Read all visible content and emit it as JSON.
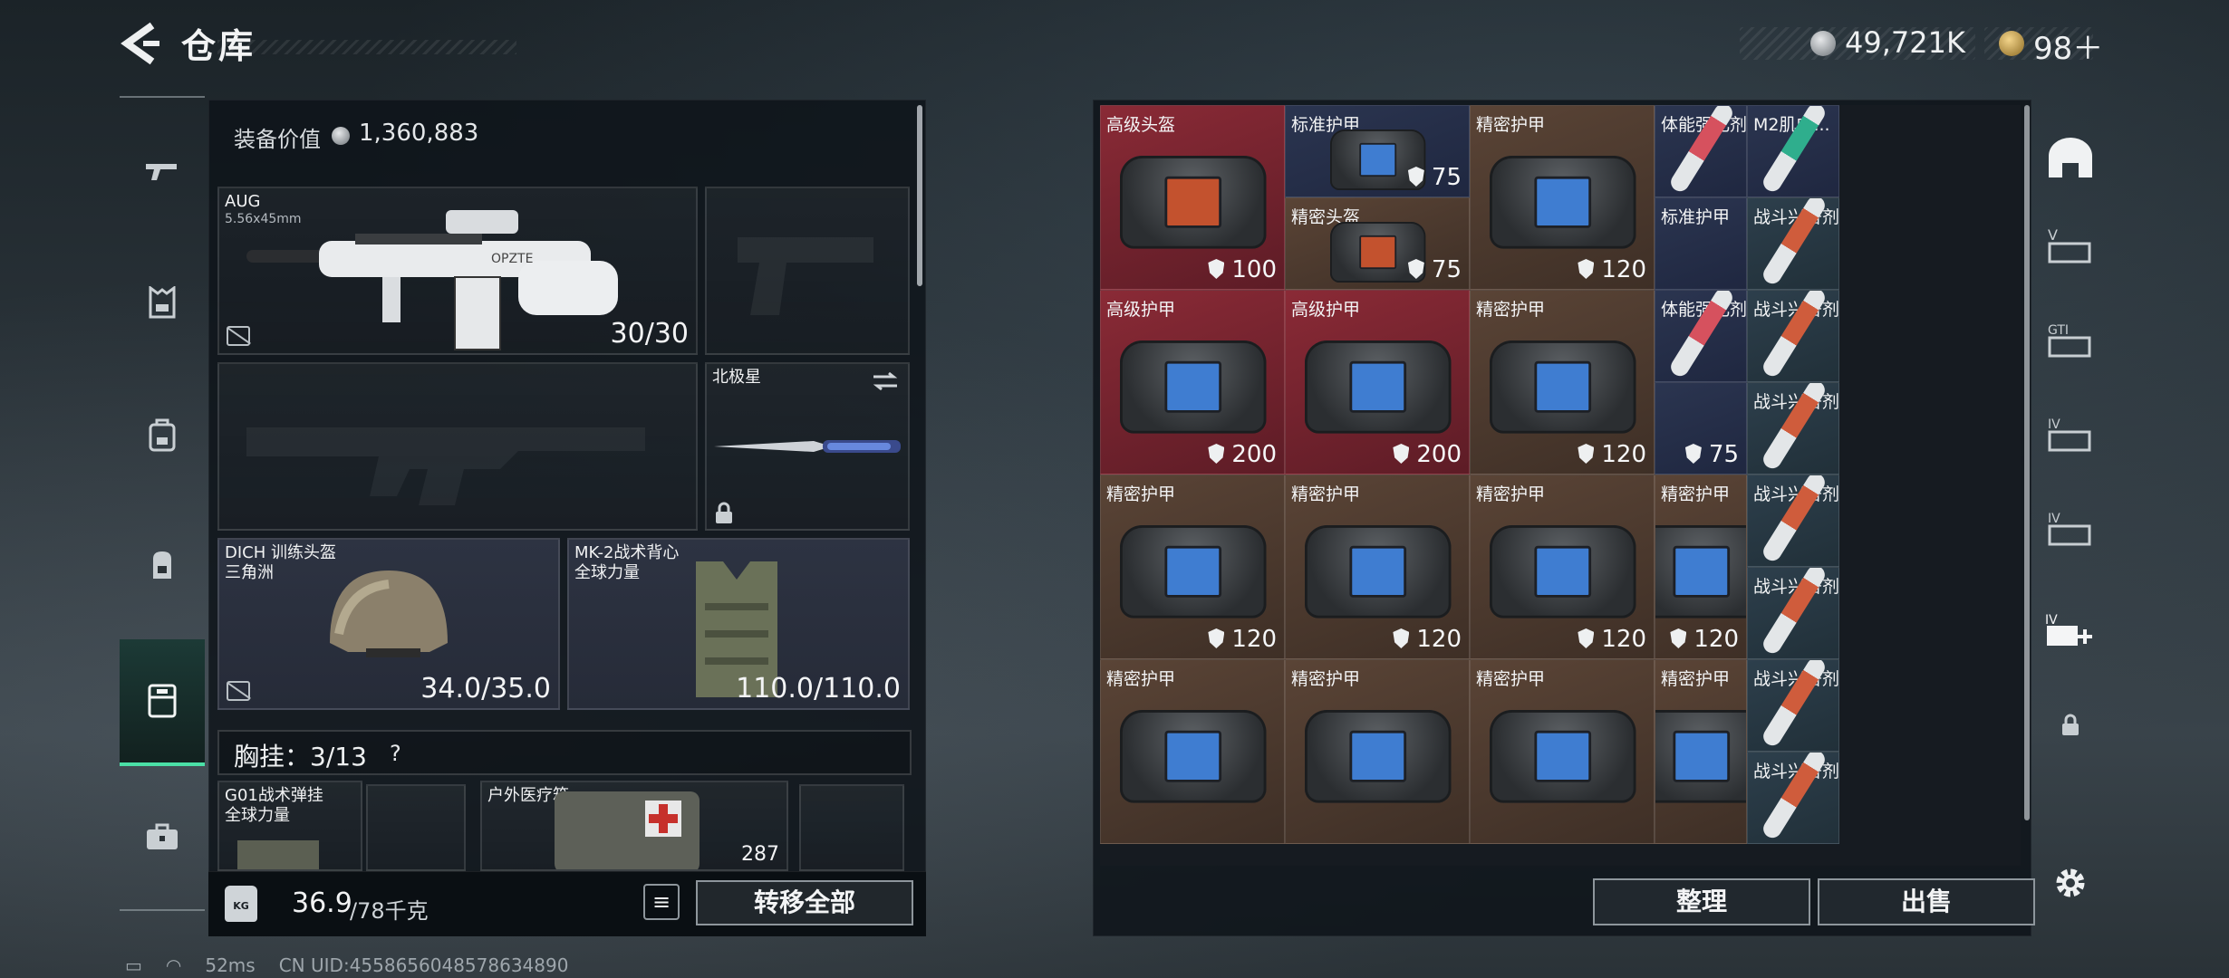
{
  "header": {
    "title": "仓库",
    "currency1": "49,721K",
    "currency2": "98＋"
  },
  "left_nav": {
    "items": [
      {
        "name": "weapon",
        "icon": "gun-icon"
      },
      {
        "name": "vest",
        "icon": "vest-icon"
      },
      {
        "name": "backpack-alt",
        "icon": "bag-icon"
      },
      {
        "name": "pack",
        "icon": "backpack-icon"
      },
      {
        "name": "storage",
        "icon": "locker-icon",
        "active": true
      },
      {
        "name": "case",
        "icon": "briefcase-icon"
      }
    ]
  },
  "equipment": {
    "value_label": "装备价值",
    "value": "1,360,883",
    "primary": {
      "name": "AUG",
      "caliber": "5.56x45mm",
      "ammo": "30/30"
    },
    "melee": {
      "name": "北极星"
    },
    "helmet": {
      "name": "DICH 训练头盔\n三角洲",
      "durability": "34.0/35.0"
    },
    "armor": {
      "name": "MK-2战术背心\n全球力量",
      "durability": "110.0/110.0"
    },
    "rig": {
      "label": "胸挂：3/13",
      "help": "?"
    },
    "rig_items": [
      {
        "name": "G01战术弹挂\n全球力量"
      },
      {
        "name": "户外医疗箱",
        "value": "287"
      }
    ]
  },
  "footer_left": {
    "weight_icon": "KG",
    "weight": "36.9",
    "weight_max": "/78千克",
    "transfer_all": "转移全部"
  },
  "grid": {
    "cells": [
      {
        "name": "高级头盔",
        "dur": "100",
        "color": "red"
      },
      {
        "name": "标准护甲",
        "dur": "75",
        "color": "blue"
      },
      {
        "name": "精密头盔",
        "dur": "75",
        "color": "brown"
      },
      {
        "name": "精密护甲",
        "dur": "120",
        "color": "brown"
      },
      {
        "name": "体能强化剂",
        "color": "blue"
      },
      {
        "name": "M2肌肉...",
        "color": "blue"
      },
      {
        "name": "标准护甲",
        "color": "blue"
      },
      {
        "name": "战斗兴奋剂",
        "color": "teal"
      },
      {
        "name": "高级护甲",
        "dur": "200",
        "color": "red"
      },
      {
        "name": "高级护甲",
        "dur": "200",
        "color": "red"
      },
      {
        "name": "精密护甲",
        "dur": "120",
        "color": "brown"
      },
      {
        "name": "体能强化剂",
        "color": "blue"
      },
      {
        "name": "",
        "dur": "75",
        "color": "blue"
      },
      {
        "name": "战斗兴奋剂",
        "color": "teal"
      },
      {
        "name": "战斗兴奋剂",
        "color": "teal"
      },
      {
        "name": "精密护甲",
        "dur": "120",
        "color": "brown"
      },
      {
        "name": "精密护甲",
        "dur": "120",
        "color": "brown"
      },
      {
        "name": "精密护甲",
        "dur": "120",
        "color": "brown"
      },
      {
        "name": "精密护甲",
        "dur": "120",
        "color": "brown"
      },
      {
        "name": "战斗兴奋剂",
        "color": "teal"
      },
      {
        "name": "战斗兴奋剂",
        "color": "teal"
      },
      {
        "name": "精密护甲",
        "color": "brown"
      },
      {
        "name": "精密护甲",
        "color": "brown"
      },
      {
        "name": "精密护甲",
        "color": "brown"
      },
      {
        "name": "精密护甲",
        "color": "brown"
      },
      {
        "name": "战斗兴奋剂",
        "color": "teal"
      },
      {
        "name": "战斗兴奋剂",
        "color": "teal"
      }
    ]
  },
  "footer_right": {
    "sort": "整理",
    "sell": "出售"
  },
  "right_nav": {
    "items": [
      "dome-icon",
      "V-storage-icon",
      "GT-storage-icon",
      "IV-storage-icon",
      "IV-storage-2-icon",
      "IV-add-icon",
      "lock-icon",
      "settings-icon"
    ]
  },
  "status": {
    "ping": "52ms",
    "uid": "CN UID:4558656048578634890"
  },
  "colors": {
    "accent": "#4be0a6",
    "red_cell": "#8a2a36",
    "brown_cell": "#5a4436",
    "blue_cell": "#2b3550",
    "teal_cell": "#2d3f4c"
  }
}
